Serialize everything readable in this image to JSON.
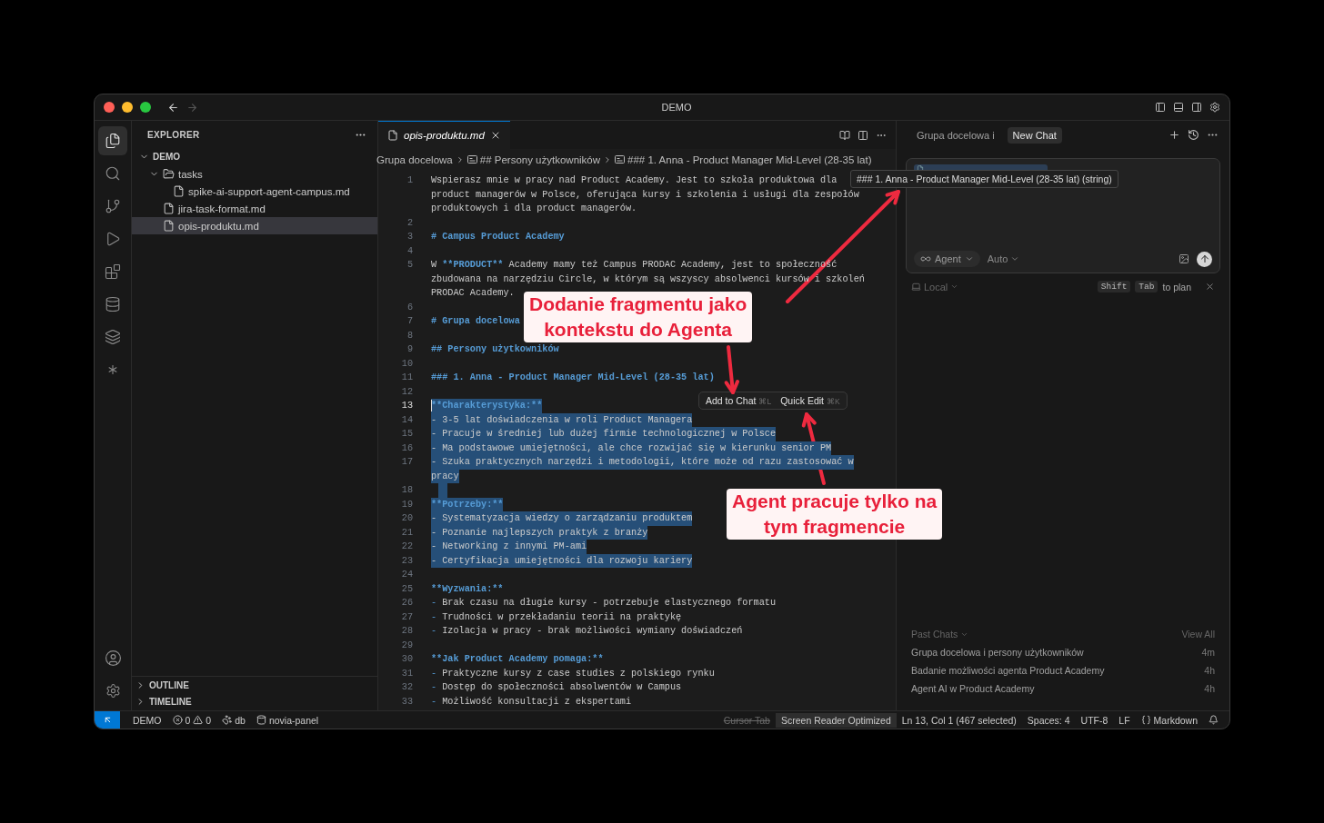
{
  "window": {
    "title": "DEMO"
  },
  "activity_bar": {
    "items": [
      {
        "selected": true
      },
      {
        "selected": false
      },
      {
        "selected": false
      },
      {
        "selected": false
      },
      {
        "selected": false
      },
      {
        "selected": false
      },
      {
        "selected": false
      },
      {
        "selected": false
      }
    ]
  },
  "sidebar": {
    "title": "EXPLORER",
    "tree": [
      {
        "label": "DEMO",
        "kind": "root",
        "expanded": true,
        "selected": false,
        "children": [
          {
            "label": "tasks",
            "kind": "folder",
            "expanded": true,
            "selected": false,
            "children": [
              {
                "label": "spike-ai-support-agent-campus.md",
                "kind": "file",
                "selected": false
              }
            ]
          },
          {
            "label": "jira-task-format.md",
            "kind": "file",
            "selected": false
          },
          {
            "label": "opis-produktu.md",
            "kind": "file",
            "selected": true
          }
        ]
      }
    ],
    "sections": [
      {
        "label": "OUTLINE",
        "expanded": false
      },
      {
        "label": "TIMELINE",
        "expanded": false
      }
    ]
  },
  "editor": {
    "tabs": [
      {
        "label": "opis-produktu.md",
        "selected": true,
        "preview": true
      }
    ],
    "breadcrumb": [
      {
        "label": "Grupa docelowa",
        "symbol": false
      },
      {
        "label": "## Persony użytkowników",
        "symbol": true
      },
      {
        "label": "### 1. Anna - Product Manager Mid-Level (28-35 lat)",
        "symbol": true
      }
    ],
    "lines": [
      {
        "number": "1",
        "selected": false,
        "active": false,
        "rows": [
          [
            {
              "text": "Wspierasz mnie w pracy nad Product Academy. Jest to szkoła produktowa dla",
              "kind": "plain"
            }
          ],
          [
            {
              "text": "product managerów w Polsce, oferująca kursy i szkolenia i usługi dla zespołów",
              "kind": "plain"
            }
          ],
          [
            {
              "text": "produktowych i dla product managerów.",
              "kind": "plain"
            }
          ]
        ]
      },
      {
        "number": "2",
        "selected": false,
        "active": false,
        "rows": [
          []
        ]
      },
      {
        "number": "3",
        "selected": false,
        "active": false,
        "rows": [
          [
            {
              "text": "# Campus Product Academy",
              "kind": "heading"
            }
          ]
        ]
      },
      {
        "number": "4",
        "selected": false,
        "active": false,
        "rows": [
          []
        ]
      },
      {
        "number": "5",
        "selected": false,
        "active": false,
        "rows": [
          [
            {
              "text": "W ",
              "kind": "plain"
            },
            {
              "text": "**PRODUCT**",
              "kind": "bold"
            },
            {
              "text": " Academy mamy też Campus PRODAC Academy, jest to społeczność",
              "kind": "plain"
            }
          ],
          [
            {
              "text": "zbudowana na narzędziu Circle, w którym są wszyscy absolwenci kursów i szkoleń",
              "kind": "plain"
            }
          ],
          [
            {
              "text": "PRODAC Academy.",
              "kind": "plain"
            }
          ]
        ]
      },
      {
        "number": "6",
        "selected": false,
        "active": false,
        "rows": [
          []
        ]
      },
      {
        "number": "7",
        "selected": false,
        "active": false,
        "rows": [
          [
            {
              "text": "# Grupa docelowa",
              "kind": "heading"
            }
          ]
        ]
      },
      {
        "number": "8",
        "selected": false,
        "active": false,
        "rows": [
          []
        ]
      },
      {
        "number": "9",
        "selected": false,
        "active": false,
        "rows": [
          [
            {
              "text": "## Persony użytkowników",
              "kind": "heading"
            }
          ]
        ]
      },
      {
        "number": "10",
        "selected": false,
        "active": false,
        "rows": [
          []
        ]
      },
      {
        "number": "11",
        "selected": false,
        "active": false,
        "rows": [
          [
            {
              "text": "### 1. Anna - Product Manager Mid-Level (28-35 lat)",
              "kind": "heading"
            }
          ]
        ]
      },
      {
        "number": "12",
        "selected": false,
        "active": false,
        "rows": [
          []
        ]
      },
      {
        "number": "13",
        "selected": true,
        "active": true,
        "rows": [
          [
            {
              "text": "**Charakterystyka:**",
              "kind": "bold"
            }
          ]
        ]
      },
      {
        "number": "14",
        "selected": true,
        "active": false,
        "rows": [
          [
            {
              "text": "- 3-5 lat doświadczenia w roli Product Managera",
              "kind": "plain"
            }
          ]
        ]
      },
      {
        "number": "15",
        "selected": true,
        "active": false,
        "rows": [
          [
            {
              "text": "- Pracuje w średniej lub dużej firmie technologicznej w Polsce",
              "kind": "plain"
            }
          ]
        ]
      },
      {
        "number": "16",
        "selected": true,
        "active": false,
        "rows": [
          [
            {
              "text": "- Ma podstawowe umiejętności, ale chce rozwijać się w kierunku senior PM",
              "kind": "plain"
            }
          ]
        ]
      },
      {
        "number": "17",
        "selected": true,
        "active": false,
        "rows": [
          [
            {
              "text": "- Szuka praktycznych narzędzi i metodologii, które może od razu zastosować w",
              "kind": "plain"
            }
          ],
          [
            {
              "text": "pracy",
              "kind": "plain"
            }
          ]
        ]
      },
      {
        "number": "18",
        "selected": true,
        "active": false,
        "rows": [
          []
        ]
      },
      {
        "number": "19",
        "selected": true,
        "active": false,
        "rows": [
          [
            {
              "text": "**Potrzeby:**",
              "kind": "bold"
            }
          ]
        ]
      },
      {
        "number": "20",
        "selected": true,
        "active": false,
        "rows": [
          [
            {
              "text": "- Systematyzacja wiedzy o zarządzaniu produktem",
              "kind": "plain"
            }
          ]
        ]
      },
      {
        "number": "21",
        "selected": true,
        "active": false,
        "rows": [
          [
            {
              "text": "- Poznanie najlepszych praktyk z branży",
              "kind": "plain"
            }
          ]
        ]
      },
      {
        "number": "22",
        "selected": true,
        "active": false,
        "rows": [
          [
            {
              "text": "- Networking z innymi PM-ami",
              "kind": "plain"
            }
          ]
        ]
      },
      {
        "number": "23",
        "selected": true,
        "active": false,
        "rows": [
          [
            {
              "text": "- Certyfikacja umiejętności dla rozwoju kariery",
              "kind": "plain"
            }
          ]
        ]
      },
      {
        "number": "24",
        "selected": false,
        "active": false,
        "rows": [
          []
        ]
      },
      {
        "number": "25",
        "selected": false,
        "active": false,
        "rows": [
          [
            {
              "text": "**Wyzwania:**",
              "kind": "bold"
            }
          ]
        ]
      },
      {
        "number": "26",
        "selected": false,
        "active": false,
        "rows": [
          [
            {
              "text": "-",
              "kind": "marker"
            },
            {
              "text": " Brak czasu na długie kursy - potrzebuje elastycznego formatu",
              "kind": "plain"
            }
          ]
        ]
      },
      {
        "number": "27",
        "selected": false,
        "active": false,
        "rows": [
          [
            {
              "text": "-",
              "kind": "marker"
            },
            {
              "text": " Trudności w przekładaniu teorii na praktykę",
              "kind": "plain"
            }
          ]
        ]
      },
      {
        "number": "28",
        "selected": false,
        "active": false,
        "rows": [
          [
            {
              "text": "-",
              "kind": "marker"
            },
            {
              "text": " Izolacja w pracy - brak możliwości wymiany doświadczeń",
              "kind": "plain"
            }
          ]
        ]
      },
      {
        "number": "29",
        "selected": false,
        "active": false,
        "rows": [
          []
        ]
      },
      {
        "number": "30",
        "selected": false,
        "active": false,
        "rows": [
          [
            {
              "text": "**Jak Product Academy pomaga:**",
              "kind": "bold"
            }
          ]
        ]
      },
      {
        "number": "31",
        "selected": false,
        "active": false,
        "rows": [
          [
            {
              "text": "-",
              "kind": "marker"
            },
            {
              "text": " Praktyczne kursy z case studies z polskiego rynku",
              "kind": "plain"
            }
          ]
        ]
      },
      {
        "number": "32",
        "selected": false,
        "active": false,
        "rows": [
          [
            {
              "text": "-",
              "kind": "marker"
            },
            {
              "text": " Dostęp do społeczności absolwentów w Campus",
              "kind": "plain"
            }
          ]
        ]
      },
      {
        "number": "33",
        "selected": false,
        "active": false,
        "rows": [
          [
            {
              "text": "-",
              "kind": "marker"
            },
            {
              "text": " Możliwość konsultacji z ekspertami",
              "kind": "plain"
            }
          ]
        ]
      }
    ],
    "selection_toolbar": [
      {
        "label": "Add to Chat",
        "shortcut": "⌘L"
      },
      {
        "label": "Quick Edit",
        "shortcut": "⌘K"
      }
    ]
  },
  "tooltip": "### 1. Anna - Product Manager Mid-Level (28-35 lat) (string)",
  "chat": {
    "tabs": [
      {
        "label": "Grupa docelowa i",
        "selected": false
      },
      {
        "label": "New Chat",
        "selected": true
      }
    ],
    "input": {
      "mode": "Agent",
      "model": "Auto"
    },
    "footer": {
      "location": "Local",
      "keys": [
        "Shift",
        "Tab"
      ],
      "hint": "to plan"
    },
    "past_chats": {
      "title": "Past Chats",
      "view_all": "View All",
      "items": [
        {
          "title": "Grupa docelowa i persony użytkowników",
          "time": "4m"
        },
        {
          "title": "Badanie możliwości agenta Product Academy",
          "time": "4h"
        },
        {
          "title": "Agent AI w Product Academy",
          "time": "4h"
        }
      ]
    }
  },
  "status_bar": {
    "left": [
      {
        "kind": "remote"
      },
      {
        "kind": "text",
        "label": "DEMO"
      },
      {
        "kind": "problems",
        "errors": "0",
        "warnings": "0"
      },
      {
        "kind": "elephant",
        "label": "db"
      },
      {
        "kind": "cylinder",
        "label": "novia-panel"
      }
    ],
    "right": [
      {
        "kind": "text",
        "label": "Cursor Tab",
        "disabled": true,
        "highlighted": false
      },
      {
        "kind": "text",
        "label": "Screen Reader Optimized",
        "disabled": false,
        "highlighted": true
      },
      {
        "kind": "text",
        "label": "Ln 13, Col 1 (467 selected)",
        "disabled": false,
        "highlighted": false
      },
      {
        "kind": "text",
        "label": "Spaces: 4",
        "disabled": false,
        "highlighted": false
      },
      {
        "kind": "text",
        "label": "UTF-8",
        "disabled": false,
        "highlighted": false
      },
      {
        "kind": "text",
        "label": "LF",
        "disabled": false,
        "highlighted": false
      },
      {
        "kind": "language",
        "label": "Markdown",
        "disabled": false,
        "highlighted": false
      },
      {
        "kind": "bell"
      }
    ]
  },
  "annotations": [
    {
      "lines": [
        "Dodanie fragmentu jako",
        "kontekstu do Agenta"
      ]
    },
    {
      "lines": [
        "Agent pracuje tylko na",
        "tym fragmencie"
      ]
    }
  ]
}
